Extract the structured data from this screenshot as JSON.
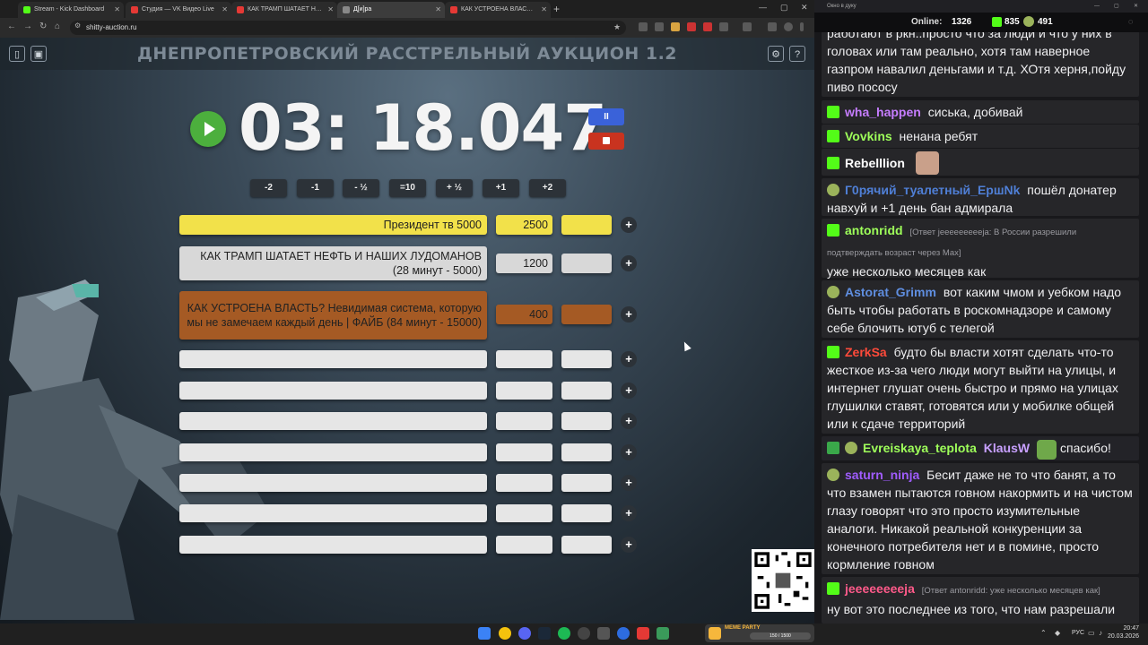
{
  "browser": {
    "tabs": [
      {
        "title": "Stream - Kick Dashboard",
        "color": "#53fc18",
        "active": false
      },
      {
        "title": "Студия — VK Видео Live",
        "color": "#e53935",
        "active": false
      },
      {
        "title": "КАК ТРАМП ШАТАЕТ НЕФТЬ И",
        "color": "#e53935",
        "active": false
      },
      {
        "title": "Д[и]ра",
        "color": "#888888",
        "active": true
      },
      {
        "title": "КАК УСТРОЕНА ВЛАСТЬ? Неви",
        "color": "#e53935",
        "active": false
      }
    ],
    "new_tab_label": "+",
    "url": "shitty-auction.ru"
  },
  "page": {
    "title": "ДНЕПРОПЕТРОВСКИЙ РАССТРЕЛЬНЫЙ АУКЦИОН 1.2",
    "timer": "03: 18.047",
    "pause_label": "II",
    "adjust_buttons": [
      "-2",
      "-1",
      "- ½",
      "=10",
      "+ ½",
      "+1",
      "+2"
    ],
    "lots": [
      {
        "name": "Президент тв 5000",
        "amount": "2500",
        "color": "yellow"
      },
      {
        "name": "КАК ТРАМП ШАТАЕТ НЕФТЬ И НАШИХ ЛУДОМАНОВ (28 минут - 5000)",
        "amount": "1200",
        "color": "grey"
      },
      {
        "name": "КАК УСТРОЕНА ВЛАСТЬ? Невидимая система, которую мы не замечаем каждый день | ФАЙБ (84 минут - 15000)",
        "amount": "400",
        "color": "brown"
      },
      {
        "name": "",
        "amount": "",
        "color": "empty"
      },
      {
        "name": "",
        "amount": "",
        "color": "empty"
      },
      {
        "name": "",
        "amount": "",
        "color": "empty"
      },
      {
        "name": "",
        "amount": "",
        "color": "empty"
      },
      {
        "name": "",
        "amount": "",
        "color": "empty"
      },
      {
        "name": "",
        "amount": "",
        "color": "empty"
      },
      {
        "name": "",
        "amount": "",
        "color": "empty"
      }
    ],
    "plus_label": "+"
  },
  "chat": {
    "window_title": "Окно в дуку",
    "online_label": "Online:",
    "online_count": "1326",
    "kick_count": "835",
    "other_count": "491",
    "messages": [
      {
        "badges": [],
        "user": "",
        "user_color": "#efeff1",
        "reply": "",
        "text": "работают в ркн..просто что за люди и что у них в головах или там реально, хотя там наверное газпром навалил деньгами и т.д. ХОтя херня,пойду пиво пососу"
      },
      {
        "badges": [
          "k"
        ],
        "user": "wha_happen",
        "user_color": "#c67dff",
        "reply": "",
        "text": "сиська, добивай"
      },
      {
        "badges": [
          "k"
        ],
        "user": "Vovkins",
        "user_color": "#9eff5a",
        "reply": "",
        "text": "ненана ребят"
      },
      {
        "badges": [
          "k"
        ],
        "user": "Rebelllion",
        "user_color": "#ffffff",
        "reply": "",
        "text": "",
        "emote": "#c9a08a"
      },
      {
        "badges": [
          "p"
        ],
        "user": "Г0рячий_туалетный_ЕршNk",
        "user_color": "#4f7fd6",
        "reply": "",
        "text": "пошёл донатер навхуй и +1 день бан адмирала"
      },
      {
        "badges": [
          "k"
        ],
        "user": "antonridd",
        "user_color": "#9eff5a",
        "reply": "[Ответ jeeeeeeeeeja: В России разрешили подтверждать возраст через Max]",
        "text": "уже несколько месяцев как"
      },
      {
        "badges": [
          "p"
        ],
        "user": "Astorat_Grimm",
        "user_color": "#5f8ee0",
        "reply": "",
        "text": "вот каким чмом и уебком надо быть чтобы работать в роскомнадзоре и самому себе блочить ютуб с телегой"
      },
      {
        "badges": [
          "k"
        ],
        "user": "ZerkSa",
        "user_color": "#ff4a3a",
        "reply": "",
        "text": "будто бы власти хотят сделать что-то жесткое из-за чего люди могут выйти на улицы, и интернет глушат очень быстро и прямо на улицах глушилки ставят, готовятся или у мобилке общей или к сдаче территорий"
      },
      {
        "badges": [
          "e",
          "p"
        ],
        "user": "Evreiskaya_teplota",
        "user_color": "#9eff5a",
        "reply": "",
        "text": "спасибо!",
        "mention": "KlausW",
        "emote": "#6fa84a"
      },
      {
        "badges": [
          "p"
        ],
        "user": "saturn_ninja",
        "user_color": "#a05cff",
        "reply": "",
        "text": "Бесит даже не то что банят, а то что взамен пытаются говном накормить и на чистом глазу говорят что это просто изумительные аналоги. Никакой реальной конкуренции за конечного потребителя нет и в помине, просто кормление говном"
      },
      {
        "badges": [
          "k"
        ],
        "user": "jeeeeeeeeja",
        "user_color": "#ff5a8a",
        "reply": "[Ответ antonridd: уже несколько месяцев как]",
        "text": "ну вот это последнее из того, что нам разрешали"
      }
    ]
  },
  "taskbar": {
    "lang": "РУС",
    "time": "20:47",
    "date": "20.03.2026",
    "meme_label": "MEME PARTY",
    "meme_count": "150 / 1500"
  }
}
